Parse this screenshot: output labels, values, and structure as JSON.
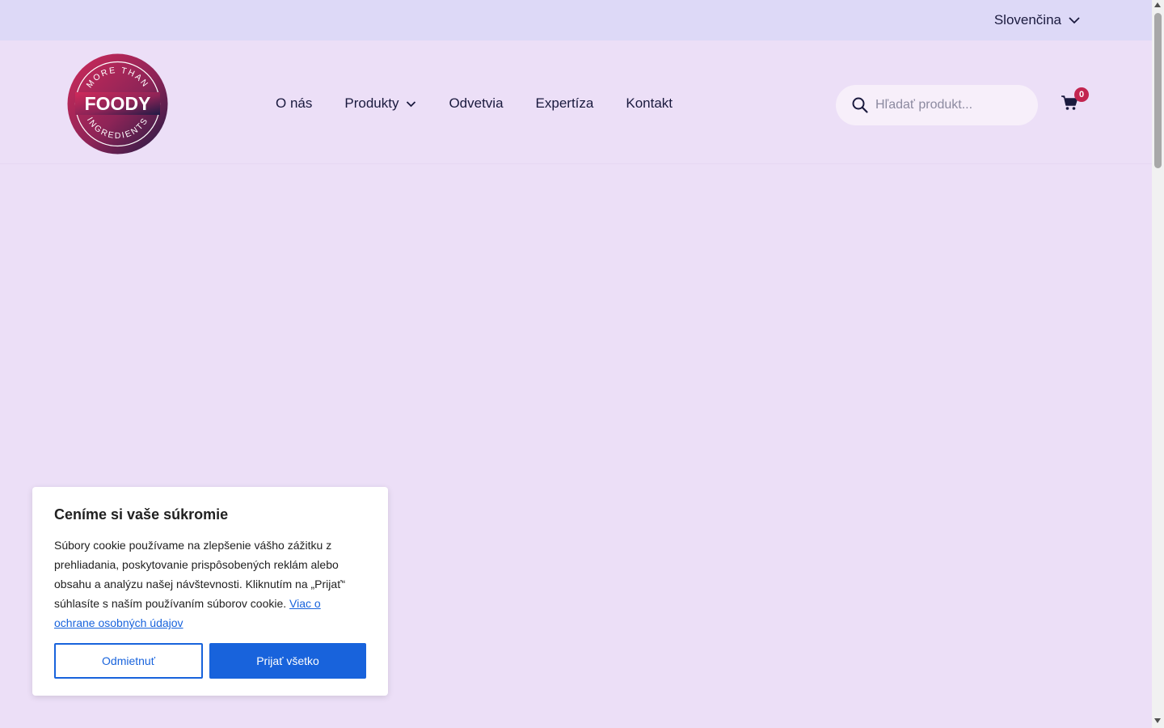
{
  "topbar": {
    "language": "Slovenčina"
  },
  "logo": {
    "top_text": "MORE THAN",
    "main_text": "FOODY",
    "bottom_text": "INGREDIENTS"
  },
  "nav": {
    "items": [
      {
        "label": "O nás",
        "has_dropdown": false
      },
      {
        "label": "Produkty",
        "has_dropdown": true
      },
      {
        "label": "Odvetvia",
        "has_dropdown": false
      },
      {
        "label": "Expertíza",
        "has_dropdown": false
      },
      {
        "label": "Kontakt",
        "has_dropdown": false
      }
    ]
  },
  "search": {
    "placeholder": "Hľadať produkt..."
  },
  "cart": {
    "count": "0"
  },
  "cookie": {
    "title": "Ceníme si vaše súkromie",
    "body": "Súbory cookie používame na zlepšenie vášho zážitku z prehliadania, poskytovanie prispôsobených reklám alebo obsahu a analýzu našej návštevnosti. Kliknutím na „Prijať“ súhlasíte s naším používaním súborov cookie.",
    "link": "Viac o ochrane osobných údajov",
    "reject": "Odmietnuť",
    "accept": "Prijať všetko"
  },
  "colors": {
    "page_bg": "#ecdff7",
    "topbar_bg": "#ddd9f7",
    "text": "#1a1a3e",
    "badge": "#c2254f",
    "accent_blue": "#1863dc"
  }
}
